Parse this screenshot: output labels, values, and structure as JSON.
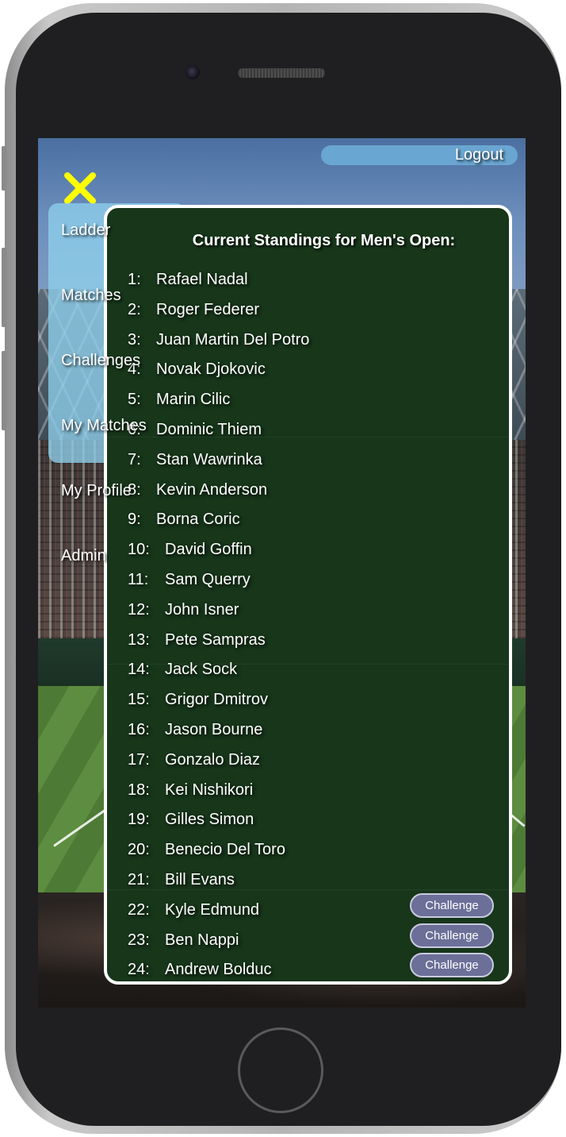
{
  "header": {
    "logout_label": "Logout"
  },
  "menu": {
    "items": [
      {
        "label": "Ladder"
      },
      {
        "label": "Matches"
      },
      {
        "label": "Challenges"
      },
      {
        "label": "My Matches"
      },
      {
        "label": "My Profile"
      },
      {
        "label": "Admin"
      }
    ]
  },
  "standings": {
    "title": "Current Standings for Men's Open:",
    "challenge_label": "Challenge",
    "rows": [
      {
        "rank": "1:",
        "name": "Rafael Nadal",
        "challenge": false
      },
      {
        "rank": "2:",
        "name": "Roger Federer",
        "challenge": false
      },
      {
        "rank": "3:",
        "name": "Juan Martin Del Potro",
        "challenge": false
      },
      {
        "rank": "4:",
        "name": "Novak Djokovic",
        "challenge": false
      },
      {
        "rank": "5:",
        "name": "Marin Cilic",
        "challenge": false
      },
      {
        "rank": "6:",
        "name": "Dominic Thiem",
        "challenge": false
      },
      {
        "rank": "7:",
        "name": "Stan Wawrinka",
        "challenge": false
      },
      {
        "rank": "8:",
        "name": "Kevin Anderson",
        "challenge": false
      },
      {
        "rank": "9:",
        "name": "Borna Coric",
        "challenge": false
      },
      {
        "rank": "10:",
        "name": "David Goffin",
        "challenge": false
      },
      {
        "rank": "11:",
        "name": "Sam Querry",
        "challenge": false
      },
      {
        "rank": "12:",
        "name": "John Isner",
        "challenge": false
      },
      {
        "rank": "13:",
        "name": "Pete Sampras",
        "challenge": false
      },
      {
        "rank": "14:",
        "name": "Jack Sock",
        "challenge": false
      },
      {
        "rank": "15:",
        "name": "Grigor Dmitrov",
        "challenge": false
      },
      {
        "rank": "16:",
        "name": "Jason Bourne",
        "challenge": false
      },
      {
        "rank": "17:",
        "name": "Gonzalo Diaz",
        "challenge": false
      },
      {
        "rank": "18:",
        "name": "Kei Nishikori",
        "challenge": false
      },
      {
        "rank": "19:",
        "name": "Gilles Simon",
        "challenge": false
      },
      {
        "rank": "20:",
        "name": "Benecio Del Toro",
        "challenge": false
      },
      {
        "rank": "21:",
        "name": "Bill Evans",
        "challenge": false
      },
      {
        "rank": "22:",
        "name": "Kyle Edmund",
        "challenge": true
      },
      {
        "rank": "23:",
        "name": "Ben Nappi",
        "challenge": true
      },
      {
        "rank": "24:",
        "name": "Andrew Bolduc",
        "challenge": true
      }
    ]
  },
  "colors": {
    "panel_bg": "#17361a",
    "menu_highlight": "#8ed0ec",
    "logout_bg": "#6aa6d2",
    "challenge_bg": "#6c6f98",
    "close_icon": "#ffff00"
  },
  "icons": {
    "close": "close-icon"
  }
}
